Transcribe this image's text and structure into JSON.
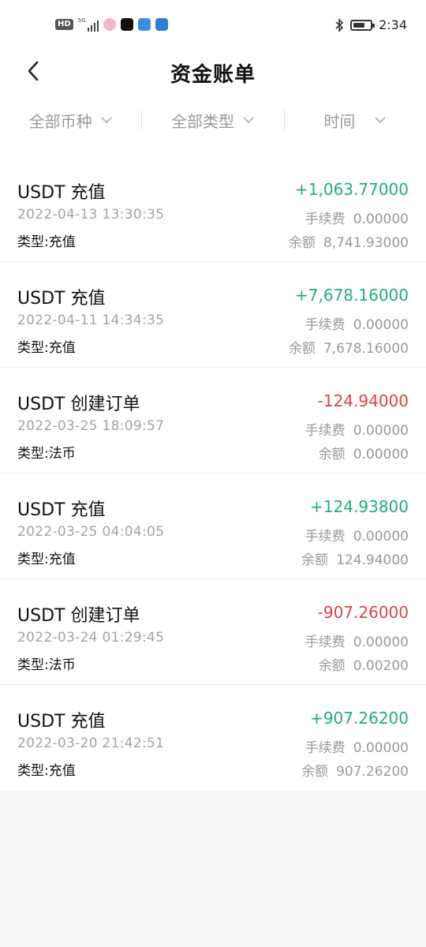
{
  "status_bar": {
    "hd": "HD",
    "network": "5G",
    "time": "2:34",
    "battery_level": 0.7,
    "app_icon_colors": [
      "#f2b6c9",
      "#111111",
      "#3b8fe0",
      "#2d7fd4"
    ]
  },
  "header": {
    "title": "资金账单"
  },
  "filters": [
    {
      "label": "全部币种"
    },
    {
      "label": "全部类型"
    },
    {
      "label": "时间"
    }
  ],
  "colors": {
    "positive": "#1fae7b",
    "negative": "#d9434e"
  },
  "records": [
    {
      "title": "USDT 充值",
      "time": "2022-04-13 13:30:35",
      "type": "类型:充值",
      "amount": "+1,063.77000",
      "sign": "pos",
      "fee_label": "手续费",
      "fee": "0.00000",
      "balance_label": "余额",
      "balance": "8,741.93000"
    },
    {
      "title": "USDT 充值",
      "time": "2022-04-11 14:34:35",
      "type": "类型:充值",
      "amount": "+7,678.16000",
      "sign": "pos",
      "fee_label": "手续费",
      "fee": "0.00000",
      "balance_label": "余额",
      "balance": "7,678.16000"
    },
    {
      "title": "USDT 创建订单",
      "time": "2022-03-25 18:09:57",
      "type": "类型:法币",
      "amount": "-124.94000",
      "sign": "neg",
      "fee_label": "手续费",
      "fee": "0.00000",
      "balance_label": "余额",
      "balance": "0.00000"
    },
    {
      "title": "USDT 充值",
      "time": "2022-03-25 04:04:05",
      "type": "类型:充值",
      "amount": "+124.93800",
      "sign": "pos",
      "fee_label": "手续费",
      "fee": "0.00000",
      "balance_label": "余额",
      "balance": "124.94000"
    },
    {
      "title": "USDT 创建订单",
      "time": "2022-03-24 01:29:45",
      "type": "类型:法币",
      "amount": "-907.26000",
      "sign": "neg",
      "fee_label": "手续费",
      "fee": "0.00000",
      "balance_label": "余额",
      "balance": "0.00200"
    },
    {
      "title": "USDT 充值",
      "time": "2022-03-20 21:42:51",
      "type": "类型:充值",
      "amount": "+907.26200",
      "sign": "pos",
      "fee_label": "手续费",
      "fee": "0.00000",
      "balance_label": "余额",
      "balance": "907.26200"
    }
  ]
}
